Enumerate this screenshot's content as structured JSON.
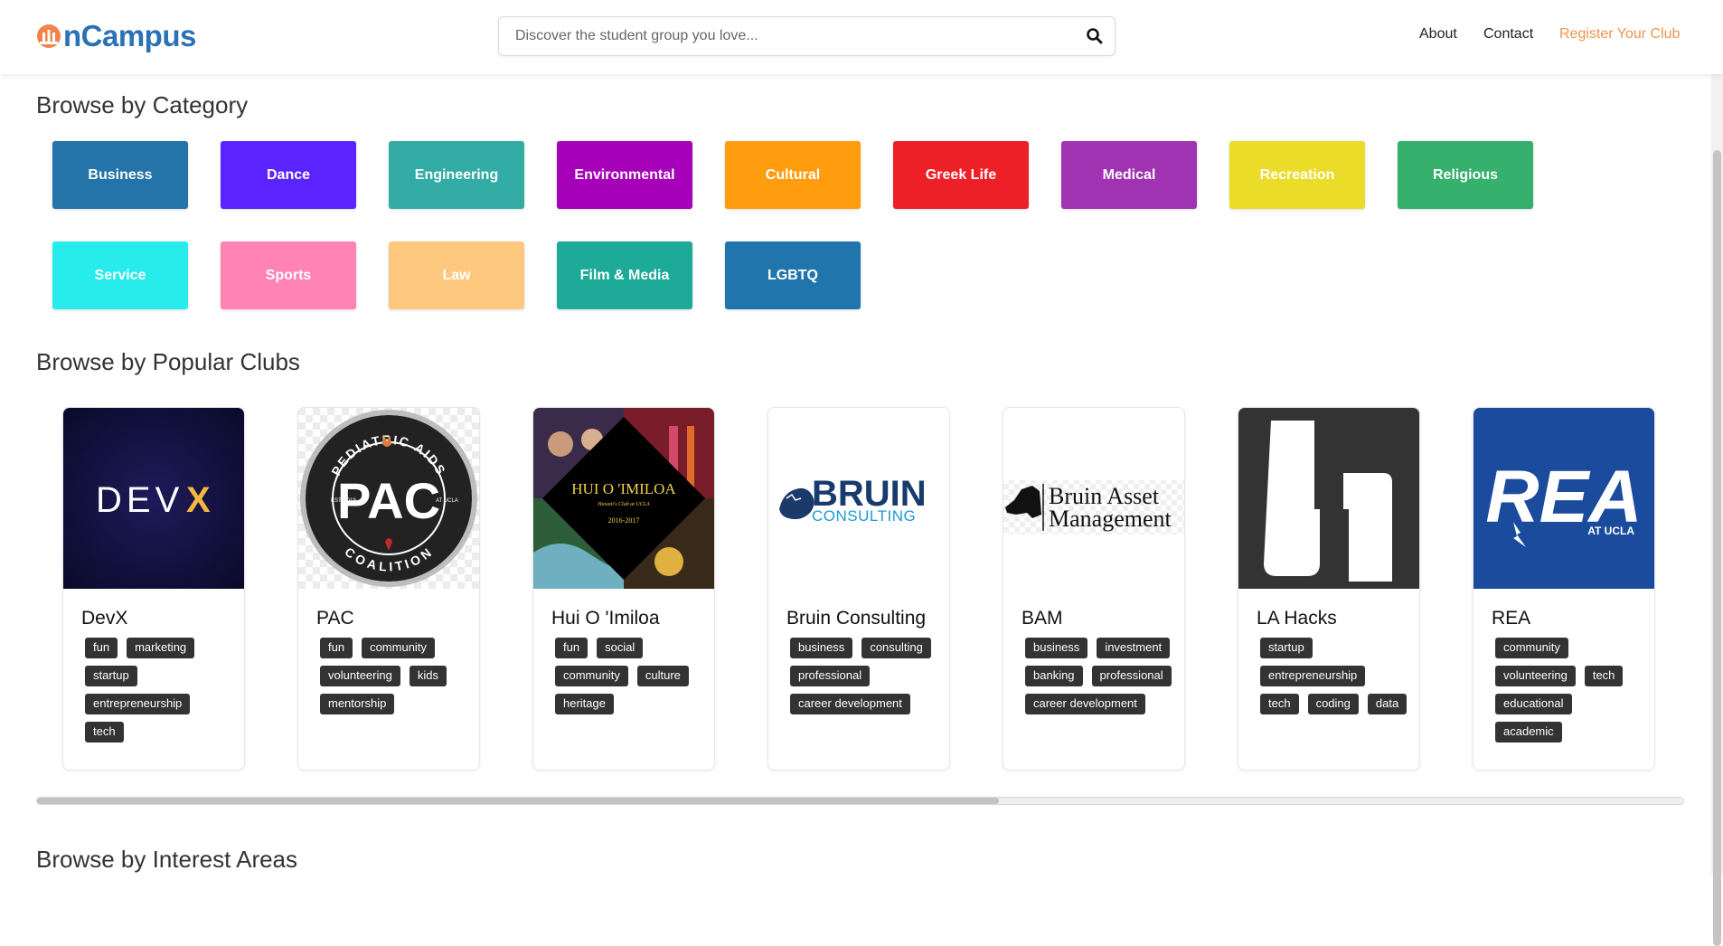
{
  "header": {
    "logo_text": "nCampus",
    "search_placeholder": "Discover the student group you love...",
    "nav": [
      {
        "label": "About"
      },
      {
        "label": "Contact"
      },
      {
        "label": "Register Your Club",
        "color": "#f0944d"
      }
    ]
  },
  "sections": {
    "category_title": "Browse by Category",
    "popular_title": "Browse by Popular Clubs",
    "interest_title": "Browse by Interest Areas"
  },
  "categories": [
    {
      "label": "Business",
      "color": "#2473a9"
    },
    {
      "label": "Dance",
      "color": "#5b24ff"
    },
    {
      "label": "Engineering",
      "color": "#33aca6"
    },
    {
      "label": "Environmental",
      "color": "#a600b9"
    },
    {
      "label": "Cultural",
      "color": "#ff9d0f"
    },
    {
      "label": "Greek Life",
      "color": "#ee2027"
    },
    {
      "label": "Medical",
      "color": "#a033b2"
    },
    {
      "label": "Recreation",
      "color": "#ecdc2a"
    },
    {
      "label": "Religious",
      "color": "#35b06d"
    },
    {
      "label": "Service",
      "color": "#28ecec"
    },
    {
      "label": "Sports",
      "color": "#ff84b4"
    },
    {
      "label": "Law",
      "color": "#fec97f"
    },
    {
      "label": "Film & Media",
      "color": "#1daa98"
    },
    {
      "label": "LGBTQ",
      "color": "#2076ac"
    }
  ],
  "clubs": [
    {
      "name": "DevX",
      "logo_text": "DEV",
      "logo_accent": "X",
      "tags": [
        "fun",
        "marketing",
        "startup",
        "entrepreneurship",
        "tech"
      ]
    },
    {
      "name": "PAC",
      "logo_text": "PAC",
      "logo_ring_top": "PEDIATRIC AIDS",
      "logo_ring_bottom": "COALITION",
      "logo_left": "EST. 2019",
      "logo_right": "AT UCLA",
      "tags": [
        "fun",
        "community",
        "volunteering",
        "kids",
        "mentorship"
      ]
    },
    {
      "name": "Hui O 'Imiloa",
      "logo_text": "HUI O 'IMILOA",
      "logo_sub": "Hawaii's Club at UCLA",
      "logo_year": "2016-2017",
      "tags": [
        "fun",
        "social",
        "community",
        "culture",
        "heritage"
      ]
    },
    {
      "name": "Bruin Consulting",
      "logo_text": "BRUIN",
      "logo_sub": "CONSULTING",
      "tags": [
        "business",
        "consulting",
        "professional",
        "career development"
      ]
    },
    {
      "name": "BAM",
      "logo_text": "Bruin Asset",
      "logo_sub": "Management",
      "tags": [
        "business",
        "investment",
        "banking",
        "professional",
        "career development"
      ]
    },
    {
      "name": "LA Hacks",
      "tags": [
        "startup",
        "entrepreneurship",
        "tech",
        "coding",
        "data"
      ]
    },
    {
      "name": "REA",
      "logo_text": "REA",
      "logo_sub": "AT UCLA",
      "tags": [
        "community",
        "volunteering",
        "tech",
        "educational",
        "academic"
      ]
    }
  ]
}
